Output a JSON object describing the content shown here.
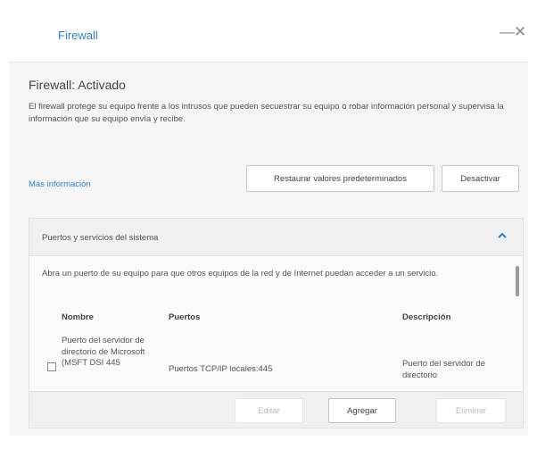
{
  "window": {
    "title": "Firewall",
    "minimize_label": "—",
    "close_label": "✕"
  },
  "status": {
    "title": "Firewall: Activado",
    "description": "El firewall protege su equipo frente a los intrusos que pueden secuestrar su equipo o robar información personal y supervisa la información que su equipo envía y recibe."
  },
  "actions": {
    "more_info": "Más información",
    "restore_defaults": "Restaurar valores predeterminados",
    "disable": "Desactivar"
  },
  "ports_section": {
    "header": "Puertos y servicios del sistema",
    "expanded": true,
    "description": "Abra un puerto de su equipo para que otros equipos de la red y de Internet puedan acceder a un servicio.",
    "columns": {
      "name": "Nombre",
      "ports": "Puertos",
      "description": "Descripción"
    },
    "rows": [
      {
        "checked": false,
        "name": "Puerto del servidor de directorio de Microsoft (MSFT DSI 445",
        "ports": "Puertos TCP/IP locales:445",
        "description": "Puerto del servidor de directorio"
      }
    ],
    "buttons": {
      "edit": "Editar",
      "add": "Agregar",
      "remove": "Eliminar"
    }
  },
  "icons": {
    "chevron": "chevron-up-icon",
    "minimize": "minimize-icon",
    "close": "close-icon"
  },
  "colors": {
    "accent": "#2e7fc4",
    "panel_bg": "#f5f5f5"
  }
}
